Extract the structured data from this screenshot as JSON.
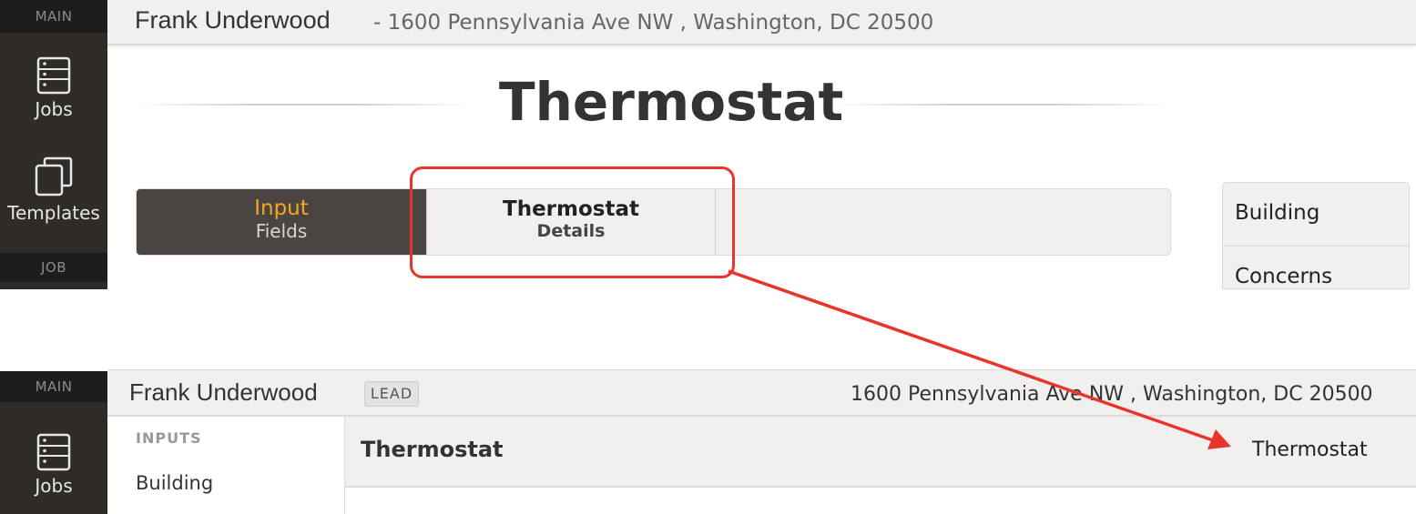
{
  "top": {
    "sidebar": {
      "section_main": "MAIN",
      "jobs_label": "Jobs",
      "templates_label": "Templates",
      "section_job": "JOB"
    },
    "header": {
      "customer_name": "Frank Underwood",
      "address": "- 1600 Pennsylvania Ave NW , Washington, DC 20500"
    },
    "page_title": "Thermostat",
    "tabs": [
      {
        "line1": "Input",
        "line2": "Fields",
        "active": true
      },
      {
        "line1": "Thermostat",
        "line2": "Details",
        "active": false
      }
    ],
    "right_nav": [
      "Building",
      "Concerns"
    ]
  },
  "bottom": {
    "sidebar": {
      "section_main": "MAIN",
      "jobs_label": "Jobs"
    },
    "header": {
      "customer_name": "Frank Underwood",
      "badge": "LEAD",
      "address": "1600 Pennsylvania Ave NW , Washington, DC 20500"
    },
    "inputs": {
      "heading": "INPUTS",
      "items": [
        "Building"
      ]
    },
    "content": {
      "title": "Thermostat",
      "right_label": "Thermostat"
    }
  },
  "colors": {
    "sidebar_bg": "#2e2b29",
    "accent_orange": "#f5a623",
    "annotation_red": "#e8352a"
  },
  "icons": {
    "jobs": "list-icon",
    "templates": "copy-icon"
  }
}
